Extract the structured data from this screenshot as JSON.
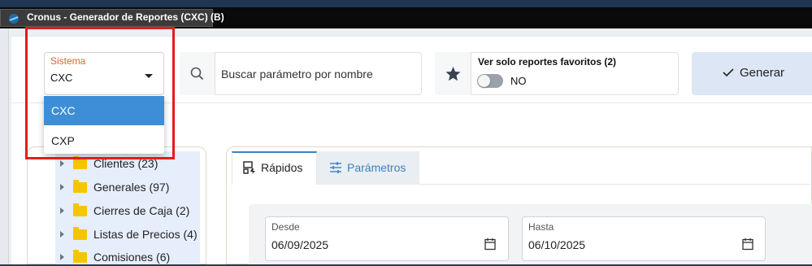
{
  "window": {
    "title": "Cronus - Generador de Reportes (CXC) (B)"
  },
  "toolbar": {
    "sistema": {
      "label": "Sistema",
      "value": "CXC",
      "options": [
        "CXC",
        "CXP"
      ]
    },
    "search": {
      "placeholder": "Buscar parámetro por nombre",
      "icon": "search-icon"
    },
    "favorites": {
      "title": "Ver solo reportes favoritos (2)",
      "toggle_text": "NO",
      "toggle_on": false,
      "icon": "star-icon"
    },
    "generate": {
      "label": "Generar",
      "icon": "check-icon"
    }
  },
  "tree": {
    "items": [
      {
        "label": "Clientes (23)"
      },
      {
        "label": "Generales (97)"
      },
      {
        "label": "Cierres de Caja (2)"
      },
      {
        "label": "Listas de Precios (4)"
      },
      {
        "label": "Comisiones (6)"
      }
    ]
  },
  "tabs": [
    {
      "label": "Rápidos",
      "active": true,
      "icon": "quick-report-icon"
    },
    {
      "label": "Parámetros",
      "active": false,
      "icon": "sliders-icon"
    }
  ],
  "dates": {
    "desde": {
      "label": "Desde",
      "value": "06/09/2025"
    },
    "hasta": {
      "label": "Hasta",
      "value": "06/10/2025"
    }
  },
  "colors": {
    "accent": "#3b82c4",
    "selected_option": "#3d8ed6",
    "highlight_box": "#e11d1d",
    "folder": "#f6c400",
    "label_orange": "#e0622f"
  }
}
